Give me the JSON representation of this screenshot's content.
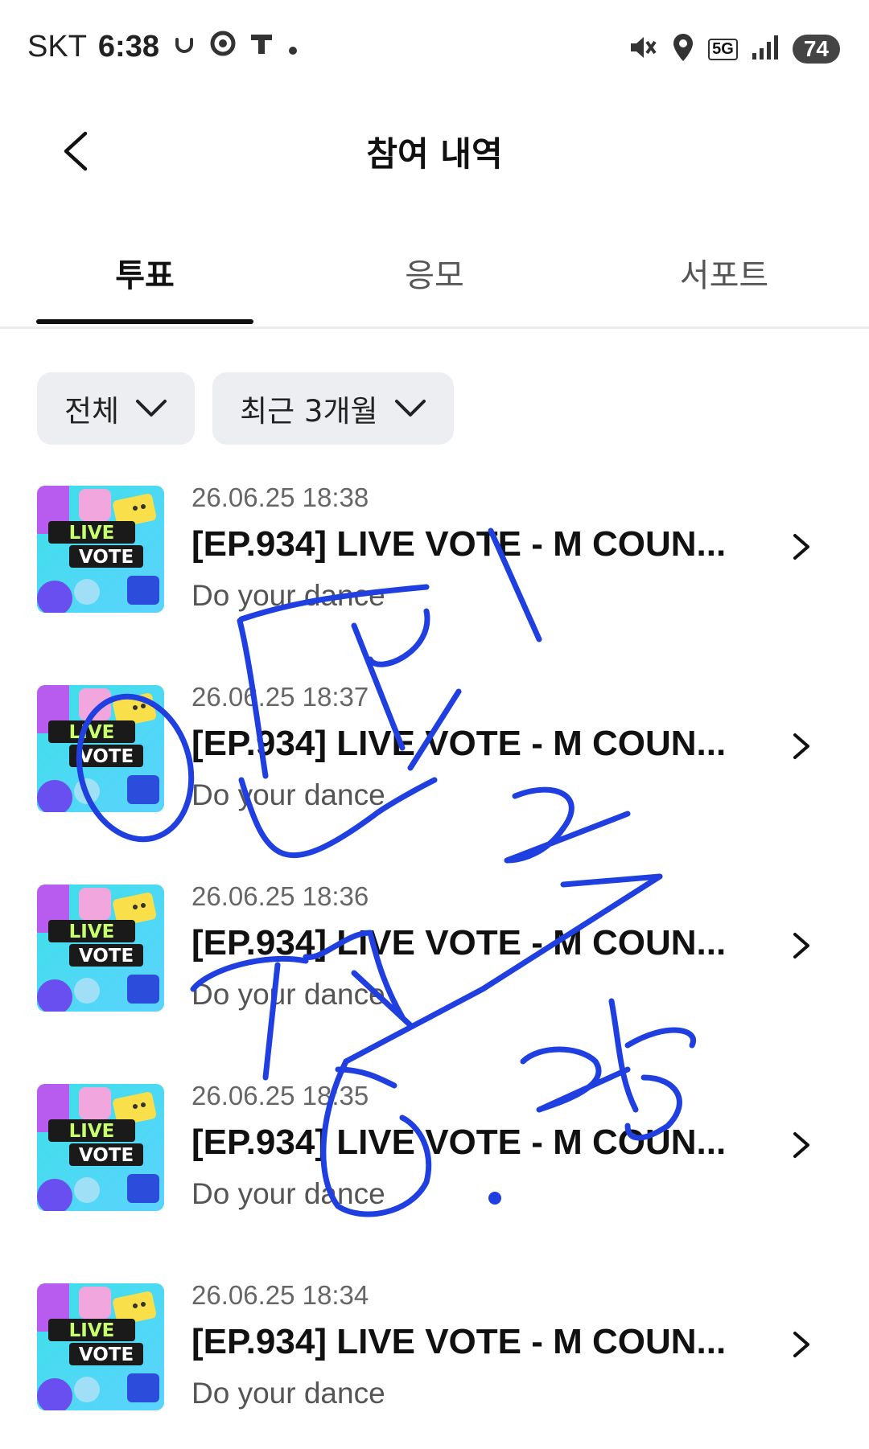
{
  "status_bar": {
    "carrier": "SKT",
    "time": "6:38",
    "network": "5G",
    "battery": "74"
  },
  "header": {
    "title": "참여 내역",
    "back_icon": "chevron-left-icon"
  },
  "tabs": [
    {
      "label": "투표",
      "active": true
    },
    {
      "label": "응모",
      "active": false
    },
    {
      "label": "서포트",
      "active": false
    }
  ],
  "filters": [
    {
      "label": "전체"
    },
    {
      "label": "최근 3개월"
    }
  ],
  "items": [
    {
      "date": "26.06.25 18:38",
      "title": "[EP.934] LIVE VOTE - M COUN...",
      "subtitle": "Do your dance"
    },
    {
      "date": "26.06.25 18:37",
      "title": "[EP.934] LIVE VOTE - M COUN...",
      "subtitle": "Do your dance"
    },
    {
      "date": "26.06.25 18:36",
      "title": "[EP.934] LIVE VOTE - M COUN...",
      "subtitle": "Do your dance"
    },
    {
      "date": "26.06.25 18:35",
      "title": "[EP.934] LIVE VOTE - M COUN...",
      "subtitle": "Do your dance"
    },
    {
      "date": "26.06.25 18:34",
      "title": "[EP.934] LIVE VOTE - M COUN...",
      "subtitle": "Do your dance"
    }
  ],
  "thumbnail": {
    "line1": "LIVE",
    "line2": "VOTE"
  },
  "colors": {
    "accent": "#111111",
    "chip_bg": "#eceef1",
    "scribble": "#1f3fe0"
  }
}
